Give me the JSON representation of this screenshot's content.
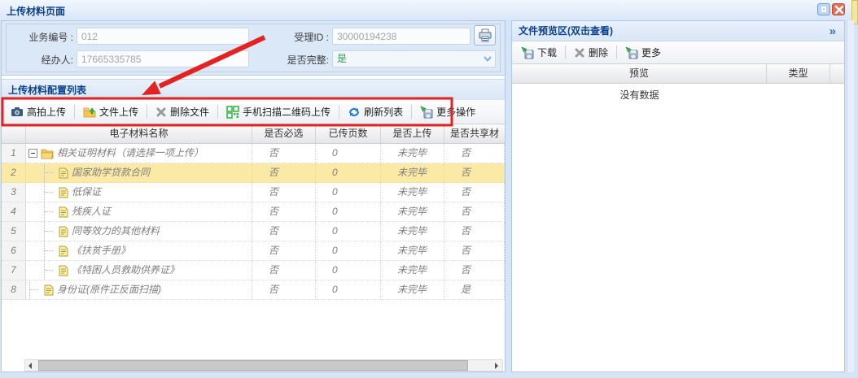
{
  "window": {
    "title": "上传材料页面"
  },
  "form": {
    "biz_no": {
      "label": "业务编号 :",
      "value": "012"
    },
    "accept_id": {
      "label": "受理ID :",
      "value": "30000194238"
    },
    "operator": {
      "label": "经办人:",
      "value": "17665335785"
    },
    "complete": {
      "label": "是否完整:",
      "value": "是"
    }
  },
  "section": {
    "title": "上传材料配置列表"
  },
  "toolbar": {
    "buttons": [
      {
        "label": "高拍上传",
        "icon": "camera-icon"
      },
      {
        "label": "文件上传",
        "icon": "file-upload-icon"
      },
      {
        "label": "删除文件",
        "icon": "delete-x-icon"
      },
      {
        "label": "手机扫描二维码上传",
        "icon": "qr-code-icon"
      },
      {
        "label": "刷新列表",
        "icon": "refresh-icon"
      },
      {
        "label": "更多操作",
        "icon": "save-more-icon"
      }
    ]
  },
  "grid": {
    "columns": {
      "name": "电子材料名称",
      "required": "是否必选",
      "pages": "已传页数",
      "uploaded": "是否上传",
      "shared": "是否共享材"
    },
    "rows": [
      {
        "num": "1",
        "name": "相关证明材料（请选择一项上传）",
        "required": "否",
        "pages": "0",
        "uploaded": "未完毕",
        "shared": "否"
      },
      {
        "num": "2",
        "name": "国家助学贷款合同",
        "required": "否",
        "pages": "0",
        "uploaded": "未完毕",
        "shared": "否"
      },
      {
        "num": "3",
        "name": "低保证",
        "required": "否",
        "pages": "0",
        "uploaded": "未完毕",
        "shared": "否"
      },
      {
        "num": "4",
        "name": "残疾人证",
        "required": "否",
        "pages": "0",
        "uploaded": "未完毕",
        "shared": "否"
      },
      {
        "num": "5",
        "name": "同等效力的其他材料",
        "required": "否",
        "pages": "0",
        "uploaded": "未完毕",
        "shared": "否"
      },
      {
        "num": "6",
        "name": "《扶贫手册》",
        "required": "否",
        "pages": "0",
        "uploaded": "未完毕",
        "shared": "否"
      },
      {
        "num": "7",
        "name": "《特困人员救助供养证》",
        "required": "否",
        "pages": "0",
        "uploaded": "未完毕",
        "shared": "否"
      },
      {
        "num": "8",
        "name": "身份证(原件正反面扫描)",
        "required": "否",
        "pages": "0",
        "uploaded": "未完毕",
        "shared": "是"
      }
    ]
  },
  "preview": {
    "title": "文件预览区(双击查看)",
    "collapse_glyph": "»",
    "toolbar": [
      {
        "label": "下载",
        "icon": "download-icon"
      },
      {
        "label": "删除",
        "icon": "delete-x-icon"
      },
      {
        "label": "更多",
        "icon": "more-icon"
      }
    ],
    "columns": {
      "preview": "预览",
      "type": "类型"
    },
    "empty": "没有数据"
  },
  "colors": {
    "accent_blue": "#0b418c",
    "annotation_red": "#e32222",
    "complete_green": "#2e9e4f",
    "selected_row": "#fbe9a6"
  }
}
